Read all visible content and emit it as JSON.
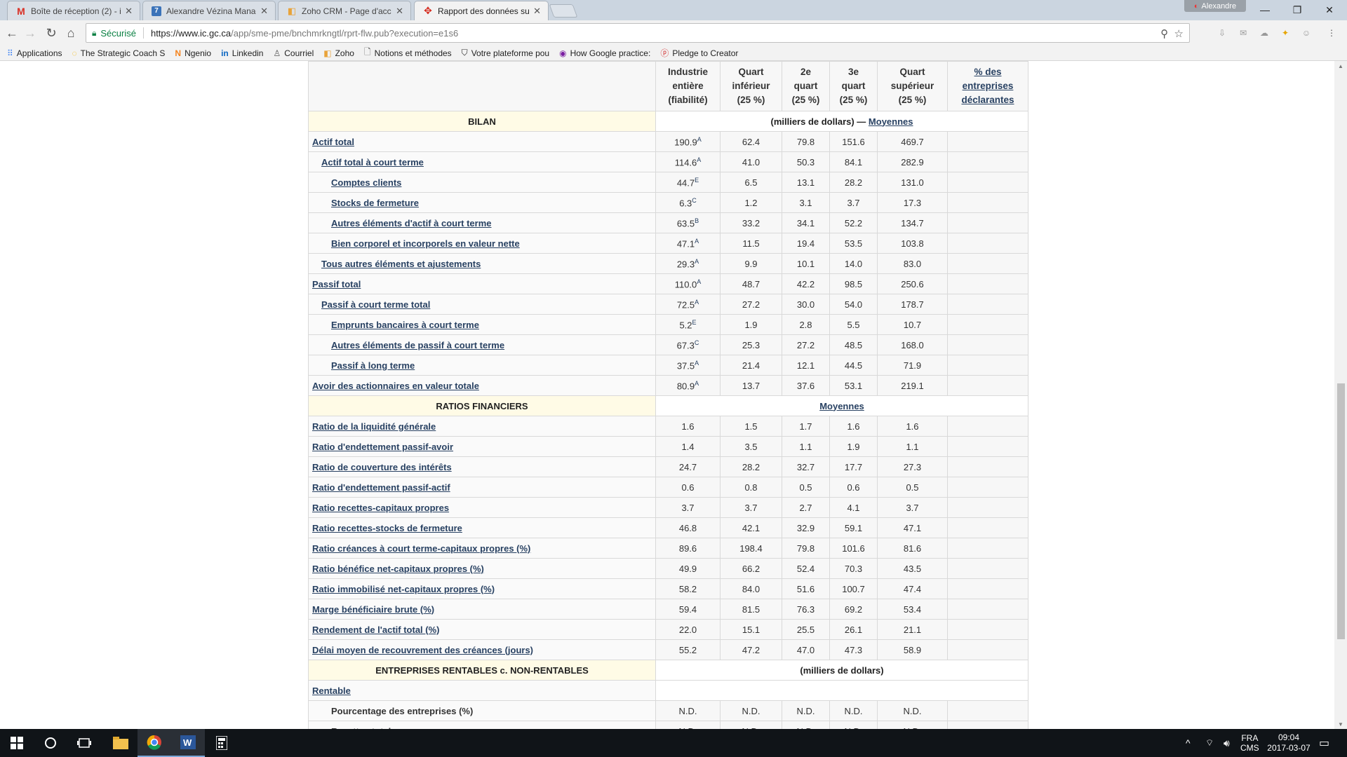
{
  "browser": {
    "tabs": [
      {
        "title": "Boîte de réception (2) - i",
        "icon": "gmail-icon",
        "color": "#d93025"
      },
      {
        "title": "Alexandre Vézina Manag",
        "icon": "seven-icon",
        "color": "#3b73b9"
      },
      {
        "title": "Zoho CRM - Page d'accu",
        "icon": "zoho-icon",
        "color": "#e8a33a"
      },
      {
        "title": "Rapport des données sur",
        "icon": "canada-flag-icon",
        "color": "#d52b1e"
      }
    ],
    "profile": "Alexandre",
    "secure_label": "Sécurisé",
    "url_host": "https://www.ic.gc.ca",
    "url_path": "/app/sme-pme/bnchmrkngtl/rprt-flw.pub?execution=e1s6",
    "bookmarks": [
      {
        "label": "Applications",
        "icon": "apps-grid-icon"
      },
      {
        "label": "The Strategic Coach S",
        "icon": "spinner-icon"
      },
      {
        "label": "Ngenio",
        "icon": "ngenio-icon"
      },
      {
        "label": "Linkedin",
        "icon": "linkedin-icon"
      },
      {
        "label": "Courriel",
        "icon": "mail-icon"
      },
      {
        "label": "Zoho",
        "icon": "zoho-icon"
      },
      {
        "label": "Notions et méthodes",
        "icon": "page-icon"
      },
      {
        "label": "Votre plateforme pou",
        "icon": "bookmark-icon"
      },
      {
        "label": "How Google practice:",
        "icon": "podcast-icon"
      },
      {
        "label": "Pledge to Creator",
        "icon": "pledge-icon"
      }
    ]
  },
  "report": {
    "headers": {
      "col1": [
        "Industrie",
        "entière",
        "(fiabilité)"
      ],
      "col2": [
        "Quart",
        "inférieur",
        "(25 %)"
      ],
      "col3": [
        "2e",
        "quart",
        "(25 %)"
      ],
      "col4": [
        "3e",
        "quart",
        "(25 %)"
      ],
      "col5": [
        "Quart",
        "supérieur",
        "(25 %)"
      ],
      "col6": [
        "% des",
        "entreprises",
        "déclarantes"
      ]
    },
    "bilan": {
      "title": "BILAN",
      "unit_prefix": "(milliers de dollars) — ",
      "unit_link": "Moyennes",
      "rows": [
        {
          "label": "Actif total",
          "level": 0,
          "v": [
            "190.9",
            "62.4",
            "79.8",
            "151.6",
            "469.7"
          ],
          "rel": "A"
        },
        {
          "label": "Actif total à court terme",
          "level": 1,
          "v": [
            "114.6",
            "41.0",
            "50.3",
            "84.1",
            "282.9"
          ],
          "rel": "A"
        },
        {
          "label": "Comptes clients",
          "level": 2,
          "v": [
            "44.7",
            "6.5",
            "13.1",
            "28.2",
            "131.0"
          ],
          "rel": "E"
        },
        {
          "label": "Stocks de fermeture",
          "level": 2,
          "v": [
            "6.3",
            "1.2",
            "3.1",
            "3.7",
            "17.3"
          ],
          "rel": "C"
        },
        {
          "label": "Autres éléments d'actif à court terme",
          "level": 2,
          "v": [
            "63.5",
            "33.2",
            "34.1",
            "52.2",
            "134.7"
          ],
          "rel": "B"
        },
        {
          "label": "Bien corporel et incorporels en valeur nette",
          "level": 2,
          "v": [
            "47.1",
            "11.5",
            "19.4",
            "53.5",
            "103.8"
          ],
          "rel": "A"
        },
        {
          "label": "Tous autres éléments et ajustements",
          "level": 1,
          "v": [
            "29.3",
            "9.9",
            "10.1",
            "14.0",
            "83.0"
          ],
          "rel": "A"
        },
        {
          "label": "Passif total",
          "level": 0,
          "v": [
            "110.0",
            "48.7",
            "42.2",
            "98.5",
            "250.6"
          ],
          "rel": "A"
        },
        {
          "label": "Passif à court terme total",
          "level": 1,
          "v": [
            "72.5",
            "27.2",
            "30.0",
            "54.0",
            "178.7"
          ],
          "rel": "A"
        },
        {
          "label": "Emprunts bancaires à court terme",
          "level": 2,
          "v": [
            "5.2",
            "1.9",
            "2.8",
            "5.5",
            "10.7"
          ],
          "rel": "E"
        },
        {
          "label": "Autres éléments de passif à court terme",
          "level": 2,
          "v": [
            "67.3",
            "25.3",
            "27.2",
            "48.5",
            "168.0"
          ],
          "rel": "C"
        },
        {
          "label": "Passif à long terme",
          "level": 2,
          "v": [
            "37.5",
            "21.4",
            "12.1",
            "44.5",
            "71.9"
          ],
          "rel": "A"
        },
        {
          "label": "Avoir des actionnaires en valeur totale",
          "level": 0,
          "v": [
            "80.9",
            "13.7",
            "37.6",
            "53.1",
            "219.1"
          ],
          "rel": "A"
        }
      ]
    },
    "ratios": {
      "title": "RATIOS FINANCIERS",
      "unit_link": "Moyennes",
      "rows": [
        {
          "label": "Ratio de la liquidité générale",
          "v": [
            "1.6",
            "1.5",
            "1.7",
            "1.6",
            "1.6"
          ]
        },
        {
          "label": "Ratio d'endettement passif-avoir",
          "v": [
            "1.4",
            "3.5",
            "1.1",
            "1.9",
            "1.1"
          ]
        },
        {
          "label": "Ratio de couverture des intérêts",
          "v": [
            "24.7",
            "28.2",
            "32.7",
            "17.7",
            "27.3"
          ]
        },
        {
          "label": "Ratio d'endettement passif-actif",
          "v": [
            "0.6",
            "0.8",
            "0.5",
            "0.6",
            "0.5"
          ]
        },
        {
          "label": "Ratio recettes-capitaux propres",
          "v": [
            "3.7",
            "3.7",
            "2.7",
            "4.1",
            "3.7"
          ]
        },
        {
          "label": "Ratio recettes-stocks de fermeture",
          "v": [
            "46.8",
            "42.1",
            "32.9",
            "59.1",
            "47.1"
          ]
        },
        {
          "label": "Ratio créances à court terme-capitaux propres (%)",
          "v": [
            "89.6",
            "198.4",
            "79.8",
            "101.6",
            "81.6"
          ]
        },
        {
          "label": "Ratio bénéfice net-capitaux propres (%)",
          "v": [
            "49.9",
            "66.2",
            "52.4",
            "70.3",
            "43.5"
          ]
        },
        {
          "label": "Ratio immobilisé net-capitaux propres (%)",
          "v": [
            "58.2",
            "84.0",
            "51.6",
            "100.7",
            "47.4"
          ]
        },
        {
          "label": "Marge bénéficiaire brute (%)",
          "v": [
            "59.4",
            "81.5",
            "76.3",
            "69.2",
            "53.4"
          ]
        },
        {
          "label": "Rendement de l'actif total (%)",
          "v": [
            "22.0",
            "15.1",
            "25.5",
            "26.1",
            "21.1"
          ]
        },
        {
          "label": "Délai moyen de recouvrement des créances (jours)",
          "v": [
            "55.2",
            "47.2",
            "47.0",
            "47.3",
            "58.9"
          ]
        }
      ]
    },
    "rentables": {
      "title": "ENTREPRISES RENTABLES c. NON-RENTABLES",
      "unit": "(milliers de dollars)",
      "group_label": "Rentable",
      "rows": [
        {
          "label": "Pourcentage des entreprises (%)",
          "v": [
            "N.D.",
            "N.D.",
            "N.D.",
            "N.D.",
            "N.D."
          ]
        },
        {
          "label": "Recettes totales",
          "v": [
            "N.D.",
            "N.D.",
            "N.D.",
            "N.D.",
            "N.D."
          ]
        }
      ]
    }
  },
  "taskbar": {
    "lang": "FRA",
    "lang2": "CMS",
    "time": "09:04",
    "date": "2017-03-07"
  },
  "colors": {
    "link": "#284162",
    "section_bg": "#fffbe6",
    "secure": "#0b8043"
  }
}
